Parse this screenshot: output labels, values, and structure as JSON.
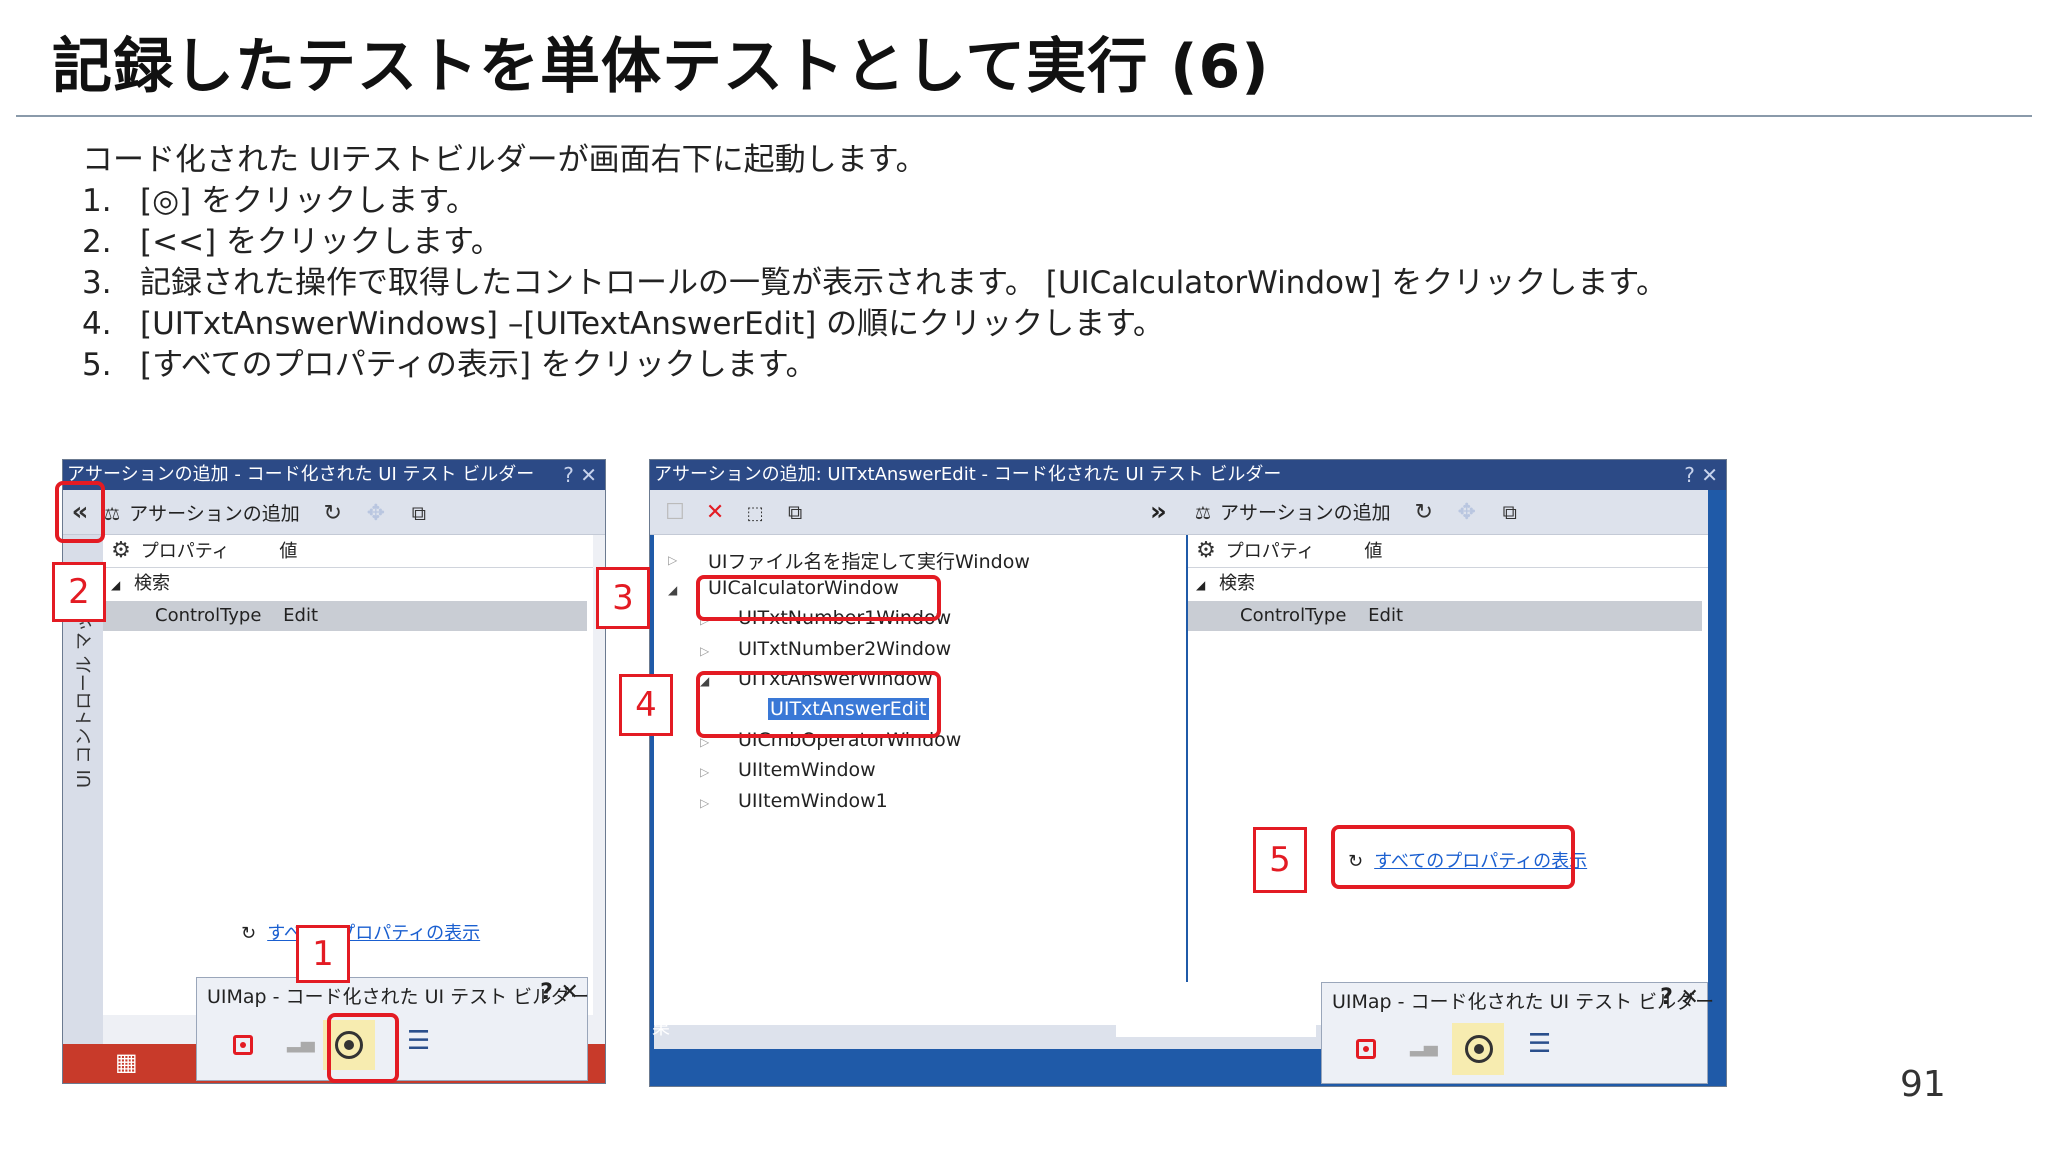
{
  "title": "記録したテストを単体テストとして実行 (6)",
  "intro": "コード化された UIテストビルダーが画面右下に起動します。",
  "steps": [
    {
      "num": "1.",
      "text": "[◎] をクリックします。"
    },
    {
      "num": "2.",
      "text": "[<<] をクリックします。"
    },
    {
      "num": "3.",
      "text": "記録された操作で取得したコントロールの一覧が表示されます。 [UICalculatorWindow] をクリックします。"
    },
    {
      "num": "4.",
      "text": "[UITxtAnswerWindows] –[UITextAnswerEdit] の順にクリックします。"
    },
    {
      "num": "5.",
      "text": "[すべてのプロパティの表示] をクリックします。"
    }
  ],
  "page_number": "91",
  "left_window": {
    "title": "アサーションの追加 - コード化された UI テスト ビルダー",
    "title_buttons": "? ✕",
    "collapse_label": "«",
    "add_assertion": "アサーションの追加",
    "grid_header_property": "プロパティ",
    "grid_header_value": "値",
    "group_search": "検索",
    "row_name": "ControlType",
    "row_value": "Edit",
    "side_label": "UI コントロール マップ",
    "show_all_link": "すべてのプロパティの表示"
  },
  "right_window": {
    "title": "アサーションの追加: UITxtAnswerEdit - コード化された UI テスト ビルダー",
    "title_buttons": "? ✕",
    "expand_label": "»",
    "add_assertion": "アサーションの追加",
    "grid_header_property": "プロパティ",
    "grid_header_value": "値",
    "group_search": "検索",
    "row_name": "ControlType",
    "row_value": "Edit",
    "show_all_link": "すべてのプロパティの表示",
    "tree": [
      {
        "label": "UIファイル名を指定して実行Window",
        "level": 0
      },
      {
        "label": "UICalculatorWindow",
        "level": 0
      },
      {
        "label": "UITxtNumber1Window",
        "level": 1
      },
      {
        "label": "UITxtNumber2Window",
        "level": 1
      },
      {
        "label": "UITxtAnswerWindow",
        "level": 1
      },
      {
        "label": "UITxtAnswerEdit",
        "level": 2
      },
      {
        "label": "UICmbOperatorWindow",
        "level": 1
      },
      {
        "label": "UIItemWindow",
        "level": 1
      },
      {
        "label": "UIItemWindow1",
        "level": 1
      }
    ],
    "bottom_left_text": "果"
  },
  "uimap_left": {
    "title": "UIMap - コード化された UI テスト ビルダー",
    "buttons": "? ✕"
  },
  "uimap_right": {
    "title": "UIMap - コード化された UI テスト ビルダー",
    "buttons": "? ✕"
  },
  "callouts": {
    "c1": "1",
    "c2": "2",
    "c3": "3",
    "c4": "4",
    "c5": "5"
  },
  "colors": {
    "callout_red": "#e31b23",
    "titlebar_blue": "#2c4a86",
    "link_blue": "#1a5fd0",
    "highlight_blue": "#3a78d6"
  }
}
